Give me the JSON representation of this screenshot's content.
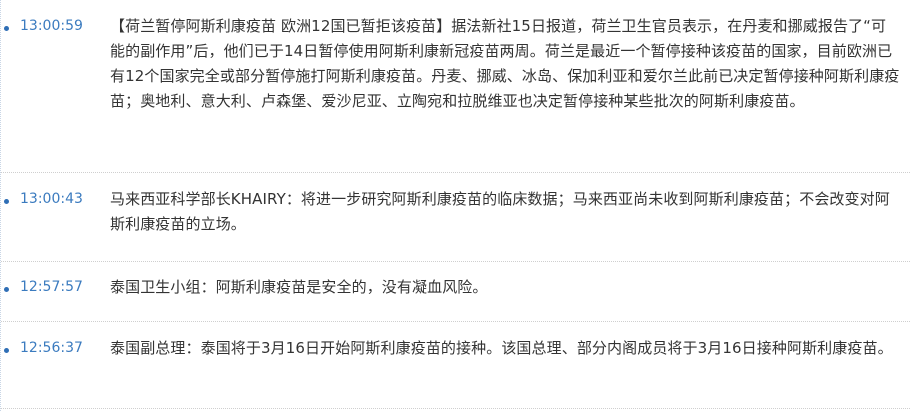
{
  "colors": {
    "time": "#3b7bbf",
    "dot": "#2f6eb5",
    "text": "#333333"
  },
  "news": [
    {
      "time": "13:00:59",
      "headline": "【荷兰暂停阿斯利康疫苗 欧洲12国已暂拒该疫苗】",
      "text": "据法新社15日报道，荷兰卫生官员表示，在丹麦和挪威报告了“可能的副作用”后，他们已于14日暂停使用阿斯利康新冠疫苗两周。荷兰是最近一个暂停接种该疫苗的国家，目前欧洲已有12个国家完全或部分暂停施打阿斯利康疫苗。丹麦、挪威、冰岛、保加利亚和爱尔兰此前已决定暂停接种阿斯利康疫苗；奥地利、意大利、卢森堡、爱沙尼亚、立陶宛和拉脱维亚也决定暂停接种某些批次的阿斯利康疫苗。"
    },
    {
      "time": "13:00:43",
      "headline": "",
      "text": "马来西亚科学部长KHAIRY：将进一步研究阿斯利康疫苗的临床数据；马来西亚尚未收到阿斯利康疫苗；不会改变对阿斯利康疫苗的立场。"
    },
    {
      "time": "12:57:57",
      "headline": "",
      "text": "泰国卫生小组：阿斯利康疫苗是安全的，没有凝血风险。"
    },
    {
      "time": "12:56:37",
      "headline": "",
      "text": "泰国副总理：泰国将于3月16日开始阿斯利康疫苗的接种。该国总理、部分内阁成员将于3月16日接种阿斯利康疫苗。"
    }
  ]
}
